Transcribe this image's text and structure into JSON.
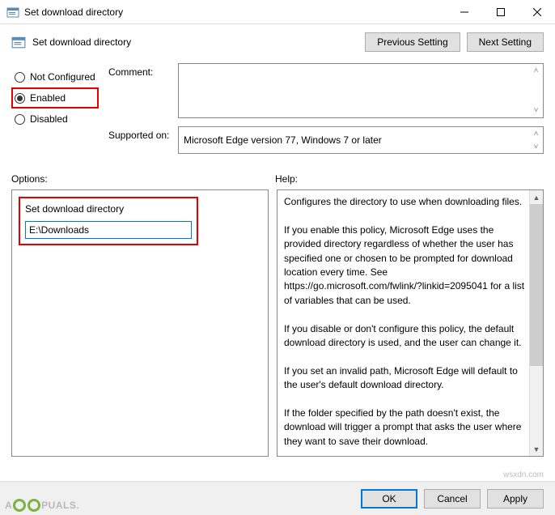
{
  "window": {
    "title": "Set download directory"
  },
  "header": {
    "title": "Set download directory",
    "prev": "Previous Setting",
    "next": "Next Setting"
  },
  "radios": {
    "not_configured": "Not Configured",
    "enabled": "Enabled",
    "disabled": "Disabled",
    "selected": "enabled"
  },
  "fields": {
    "comment_label": "Comment:",
    "comment_value": "",
    "supported_label": "Supported on:",
    "supported_value": "Microsoft Edge version 77, Windows 7 or later"
  },
  "sections": {
    "options_label": "Options:",
    "help_label": "Help:"
  },
  "options": {
    "field_label": "Set download directory",
    "field_value": "E:\\Downloads"
  },
  "help": {
    "text": "Configures the directory to use when downloading files.\n\nIf you enable this policy, Microsoft Edge uses the provided directory regardless of whether the user has specified one or chosen to be prompted for download location every time. See https://go.microsoft.com/fwlink/?linkid=2095041 for a list of variables that can be used.\n\nIf you disable or don't configure this policy, the default download directory is used, and the user can change it.\n\nIf you set an invalid path, Microsoft Edge will default to the user's default download directory.\n\nIf the folder specified by the path doesn't exist, the download will trigger a prompt that asks the user where they want to save their download.\n\nExample value:\n      Linux-based OSes (including Mac): /home/${user_name}/Downloads"
  },
  "footer": {
    "ok": "OK",
    "cancel": "Cancel",
    "apply": "Apply"
  },
  "watermark": {
    "brand_left": "A",
    "brand_right": "PUALS.",
    "site": "wsxdn.com"
  }
}
